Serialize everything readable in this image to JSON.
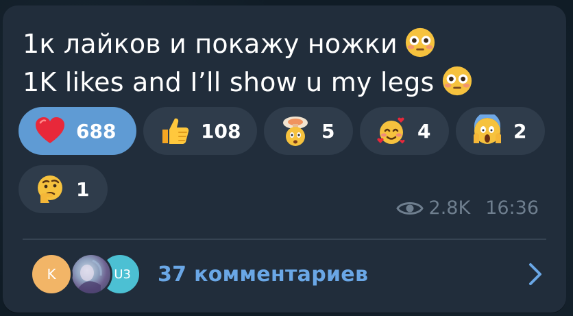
{
  "message": {
    "line1": "1к лайков и покажу ножки",
    "line2": "1K likes and I’ll show u my legs",
    "inline_emoji": "flushed-face"
  },
  "reactions": [
    {
      "emoji": "red-heart",
      "count": "688",
      "active": true
    },
    {
      "emoji": "thumbs-up",
      "count": "108",
      "active": false
    },
    {
      "emoji": "exploding-head",
      "count": "5",
      "active": false
    },
    {
      "emoji": "smiling-face-with-hearts",
      "count": "4",
      "active": false
    },
    {
      "emoji": "face-screaming-in-fear",
      "count": "2",
      "active": false
    },
    {
      "emoji": "thinking-face",
      "count": "1",
      "active": false
    }
  ],
  "meta": {
    "views": "2.8K",
    "time": "16:36"
  },
  "comments": {
    "avatars": [
      {
        "initial": "K",
        "color": "#f2b567"
      },
      {
        "initial": "",
        "color": "photo"
      },
      {
        "initial": "U3",
        "color": "#4cc0d3"
      }
    ],
    "label": "37 комментариев",
    "accent": "#6aa7e6"
  },
  "colors": {
    "bubble": "#212d3b",
    "reaction_bg": "#2f3c4b",
    "reaction_active": "#5f9bd4",
    "meta_text": "#6f7f8f"
  }
}
